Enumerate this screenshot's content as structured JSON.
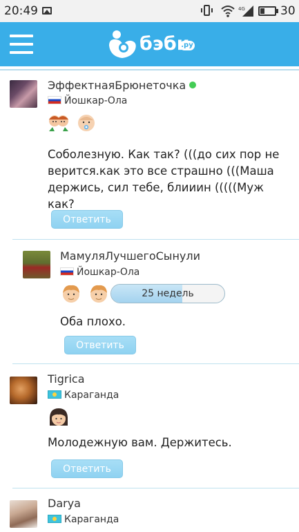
{
  "status_bar": {
    "time": "20:49",
    "network": "4G",
    "battery": "30",
    "battery_level": 0.3,
    "icons": [
      "image-icon",
      "vibrate-icon",
      "wifi-icon",
      "signal-icon",
      "battery-icon"
    ]
  },
  "header": {
    "brand": "бэби",
    "brand_suffix": ".ру",
    "menu_icon": "hamburger-menu-icon",
    "colors": {
      "bar": "#39aee8",
      "reply_button": "#8fd2f1",
      "online": "#44cc55"
    }
  },
  "comments": [
    {
      "user": "ЭффектнаяБрюнеточка",
      "online": true,
      "flag": "russia-flag-icon",
      "city": "Йошкар-Ола",
      "kids": [
        "twin-girls-icon",
        "baby-boy-icon"
      ],
      "text": "Соболезную. Как так? (((до сих пор не верится.как это все страшно (((Маша держись, сил тебе, блииин (((((Муж как?",
      "reply_label": "Ответить"
    },
    {
      "user": "МамуляЛучшегоСынули",
      "online": false,
      "flag": "russia-flag-icon",
      "city": "Йошкар-Ола",
      "kids": [
        "boy-icon",
        "boy-icon"
      ],
      "pregnancy_label": "25 недель",
      "pregnancy_progress": 0.625,
      "text": "Оба плохо.",
      "reply_label": "Ответить"
    },
    {
      "user": "Tigrica",
      "online": false,
      "flag": "kazakhstan-flag-icon",
      "city": "Караганда",
      "kids": [
        "girl-icon"
      ],
      "text": "Молодежную вам. Держитесь.",
      "reply_label": "Ответить"
    },
    {
      "user": "Darya",
      "online": false,
      "flag": "kazakhstan-flag-icon",
      "city": "Караганда"
    }
  ]
}
